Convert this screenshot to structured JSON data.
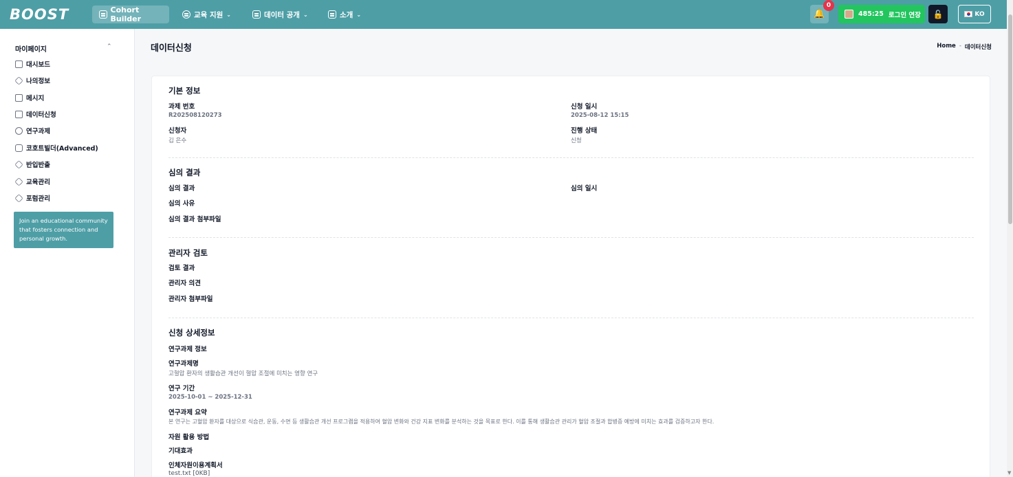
{
  "topbar": {
    "logo": "BOOST",
    "cohort_builder": "Cohort Builder",
    "nav": [
      {
        "label": "교육 지원"
      },
      {
        "label": "데이터 공개"
      },
      {
        "label": "소개"
      }
    ],
    "notification_count": "0",
    "session_timer": "485:25",
    "session_extend": "로그인 연장",
    "language": "KO"
  },
  "sidebar": {
    "heading": "마이페이지",
    "items": [
      {
        "label": "대시보드",
        "icon": "document-icon"
      },
      {
        "label": "나의정보",
        "icon": "layers-icon"
      },
      {
        "label": "메시지",
        "icon": "document-icon"
      },
      {
        "label": "데이터신청",
        "icon": "list-icon"
      },
      {
        "label": "연구과제",
        "icon": "chart-pie-icon"
      },
      {
        "label": "코호트빌더(Advanced)",
        "icon": "chart-icon"
      },
      {
        "label": "반입반출",
        "icon": "layers-icon"
      },
      {
        "label": "교육관리",
        "icon": "layers-icon"
      },
      {
        "label": "포럼관리",
        "icon": "layers-icon"
      }
    ],
    "promo": "Join an educational community that fosters connection and personal growth."
  },
  "page": {
    "title": "데이터신청",
    "breadcrumb": {
      "home": "Home",
      "sep": "-",
      "current": "데이터신청"
    }
  },
  "basic": {
    "title": "기본 정보",
    "task_no_label": "과제 번호",
    "task_no": "R202508120273",
    "applied_at_label": "신청 일시",
    "applied_at": "2025-08-12 15:15",
    "applicant_label": "신청자",
    "applicant": "김 은수",
    "status_label": "진행 상태",
    "status": "신청"
  },
  "review": {
    "title": "심의 결과",
    "result_label": "심의 결과",
    "date_label": "심의 일시",
    "reason_label": "심의 사유",
    "attachment_label": "심의 결과 첨부파일"
  },
  "admin": {
    "title": "관리자 검토",
    "result_label": "검토 결과",
    "opinion_label": "관리자 의견",
    "attachment_label": "관리자 첨부파일"
  },
  "detail": {
    "title": "신청 상세정보",
    "project_info_label": "연구과제 정보",
    "project_name_label": "연구과제명",
    "project_name": "고혈압 환자의 생활습관 개선이 혈압 조절에 미치는 영향 연구",
    "period_label": "연구 기간",
    "period": "2025-10-01 ~ 2025-12-31",
    "summary_label": "연구과제 요약",
    "summary": "본 연구는 고혈압 환자를 대상으로 식습관, 운동, 수면 등 생활습관 개선 프로그램을 적용하여 혈압 변화와 건강 지표 변화를 분석하는 것을 목표로 한다. 이를 통해 생활습관 관리가 혈압 조절과 합병증 예방에 미치는 효과를 검증하고자 한다.",
    "usage_label": "자원 활용 방법",
    "effect_label": "기대효과",
    "plan_label": "인체자원이용계획서",
    "plan_file": "test.txt [0KB]"
  }
}
